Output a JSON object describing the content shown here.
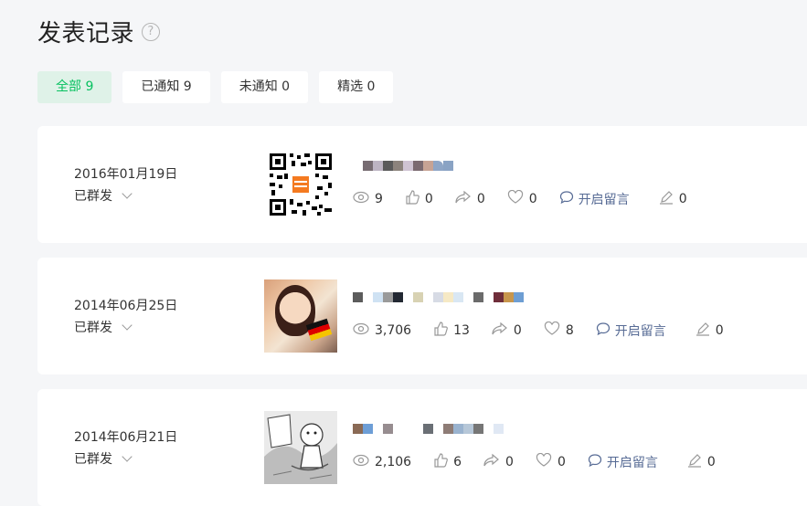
{
  "page": {
    "title": "发表记录",
    "help_icon": "question-circle-icon"
  },
  "tabs": [
    {
      "label": "全部 9",
      "active": true
    },
    {
      "label": "已通知 9",
      "active": false
    },
    {
      "label": "未通知 0",
      "active": false
    },
    {
      "label": "精选 0",
      "active": false
    }
  ],
  "posts": [
    {
      "date": "2016年01月19日",
      "status": "已群发",
      "thumbnail": "qr-code-image",
      "stats": {
        "views": "9",
        "likes": "0",
        "shares": "0",
        "favorites": "0",
        "comment_label": "开启留言",
        "edits": "0"
      }
    },
    {
      "date": "2014年06月25日",
      "status": "已群发",
      "thumbnail": "photo-girl-image",
      "stats": {
        "views": "3,706",
        "likes": "13",
        "shares": "0",
        "favorites": "8",
        "comment_label": "开启留言",
        "edits": "0"
      }
    },
    {
      "date": "2014年06月21日",
      "status": "已群发",
      "thumbnail": "sketch-cartoon-image",
      "stats": {
        "views": "2,106",
        "likes": "6",
        "shares": "0",
        "favorites": "0",
        "comment_label": "开启留言",
        "edits": "0"
      }
    }
  ],
  "colors": {
    "accent": "#07c160",
    "link": "#576b95",
    "background": "#f5f6f8"
  }
}
